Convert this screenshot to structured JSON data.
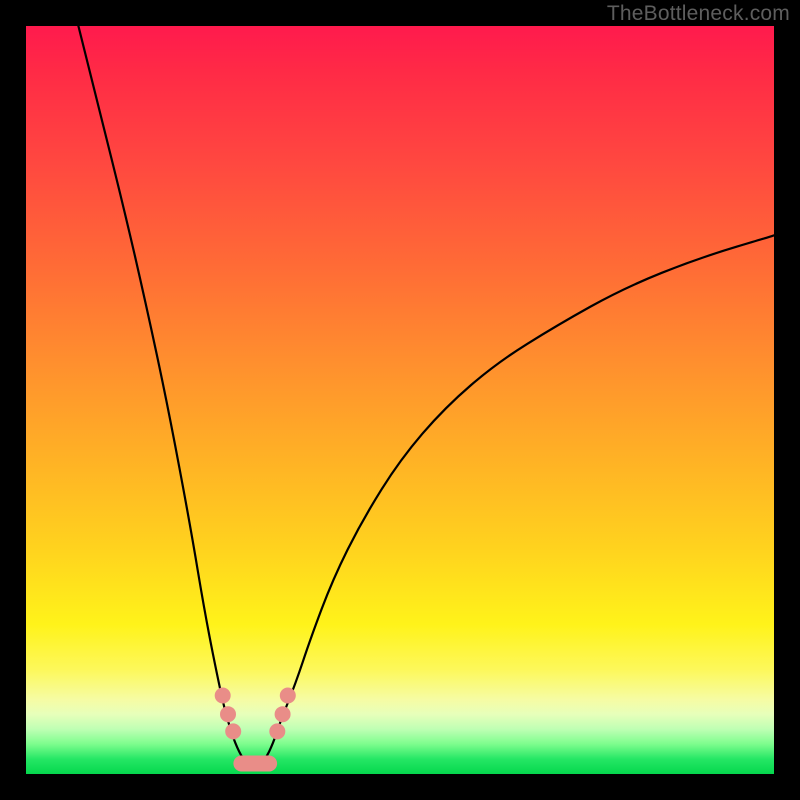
{
  "watermark": "TheBottleneck.com",
  "colors": {
    "frame": "#000000",
    "curve": "#000000",
    "marker": "#e98d88",
    "gradient_top": "#ff1a4d",
    "gradient_bottom": "#05d74d"
  },
  "chart_data": {
    "type": "line",
    "title": "",
    "xlabel": "",
    "ylabel": "",
    "xlim": [
      0,
      100
    ],
    "ylim": [
      0,
      100
    ],
    "series": [
      {
        "name": "bottleneck-curve",
        "x": [
          7,
          10,
          13,
          16,
          19,
          22,
          24,
          26,
          27,
          28,
          29,
          30,
          31,
          32,
          33,
          34,
          36,
          38,
          41,
          45,
          50,
          56,
          63,
          71,
          80,
          90,
          100
        ],
        "y": [
          100,
          88,
          76,
          63,
          49,
          33,
          21,
          11,
          7,
          4,
          2,
          1,
          1,
          2,
          4,
          7,
          12,
          18,
          26,
          34,
          42,
          49,
          55,
          60,
          65,
          69,
          72
        ]
      }
    ],
    "markers": {
      "name": "highlighted-points",
      "x": [
        26.3,
        27.0,
        27.7,
        28.8,
        30.0,
        31.2,
        32.5,
        33.6,
        34.3,
        35.0
      ],
      "y": [
        10.5,
        8.0,
        5.7,
        1.8,
        1.0,
        1.0,
        1.8,
        5.7,
        8.0,
        10.5
      ]
    },
    "annotations": []
  }
}
